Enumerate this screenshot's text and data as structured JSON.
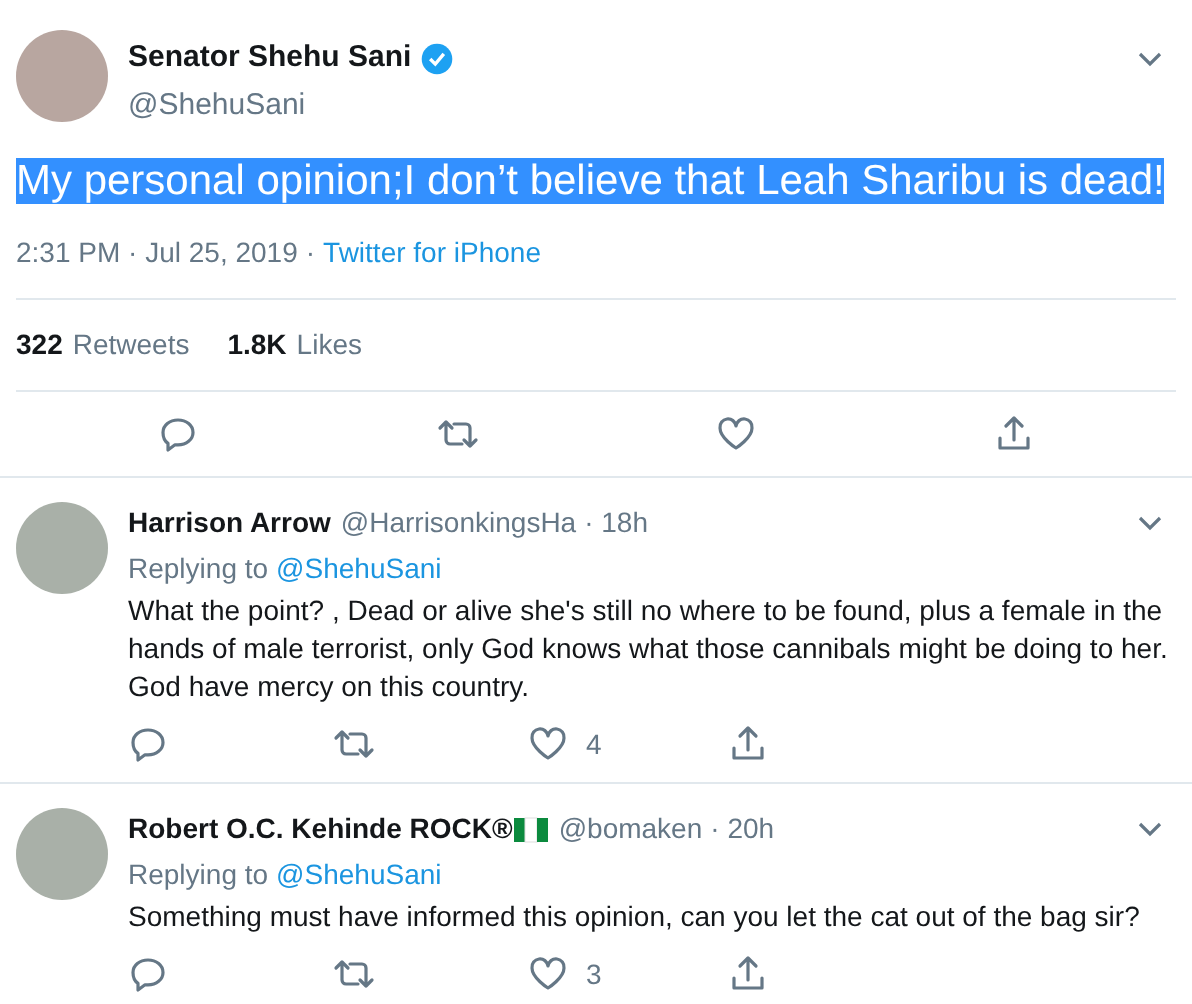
{
  "tweet": {
    "author": {
      "name": "Senator Shehu Sani",
      "verified": true,
      "handle": "@ShehuSani"
    },
    "text": "My personal opinion;I don’t believe that Leah Sharibu is dead!",
    "highlighted": true,
    "time": "2:31 PM · Jul 25, 2019",
    "separator": "·",
    "source": "Twitter for iPhone",
    "stats": [
      {
        "count": "322",
        "label": "Retweets"
      },
      {
        "count": "1.8K",
        "label": "Likes"
      }
    ]
  },
  "replies": [
    {
      "name": "Harrison Arrow",
      "flag": false,
      "handle": "@HarrisonkingsHa",
      "time": "· 18h",
      "replying_label": "Replying to",
      "replying_to": "@ShehuSani",
      "text": "What the point? , Dead or alive she's still no where to be found, plus a female in the hands of male terrorist, only God knows what those cannibals might be doing to her. God have mercy on this country.",
      "likes": "4"
    },
    {
      "name": "Robert O.C. Kehinde ROCK®",
      "flag": true,
      "handle": "@bomaken",
      "time": "· 20h",
      "replying_label": "Replying to",
      "replying_to": "@ShehuSani",
      "text": "Something must have informed this opinion, can you let the cat out of the bag sir?",
      "likes": "3"
    }
  ]
}
